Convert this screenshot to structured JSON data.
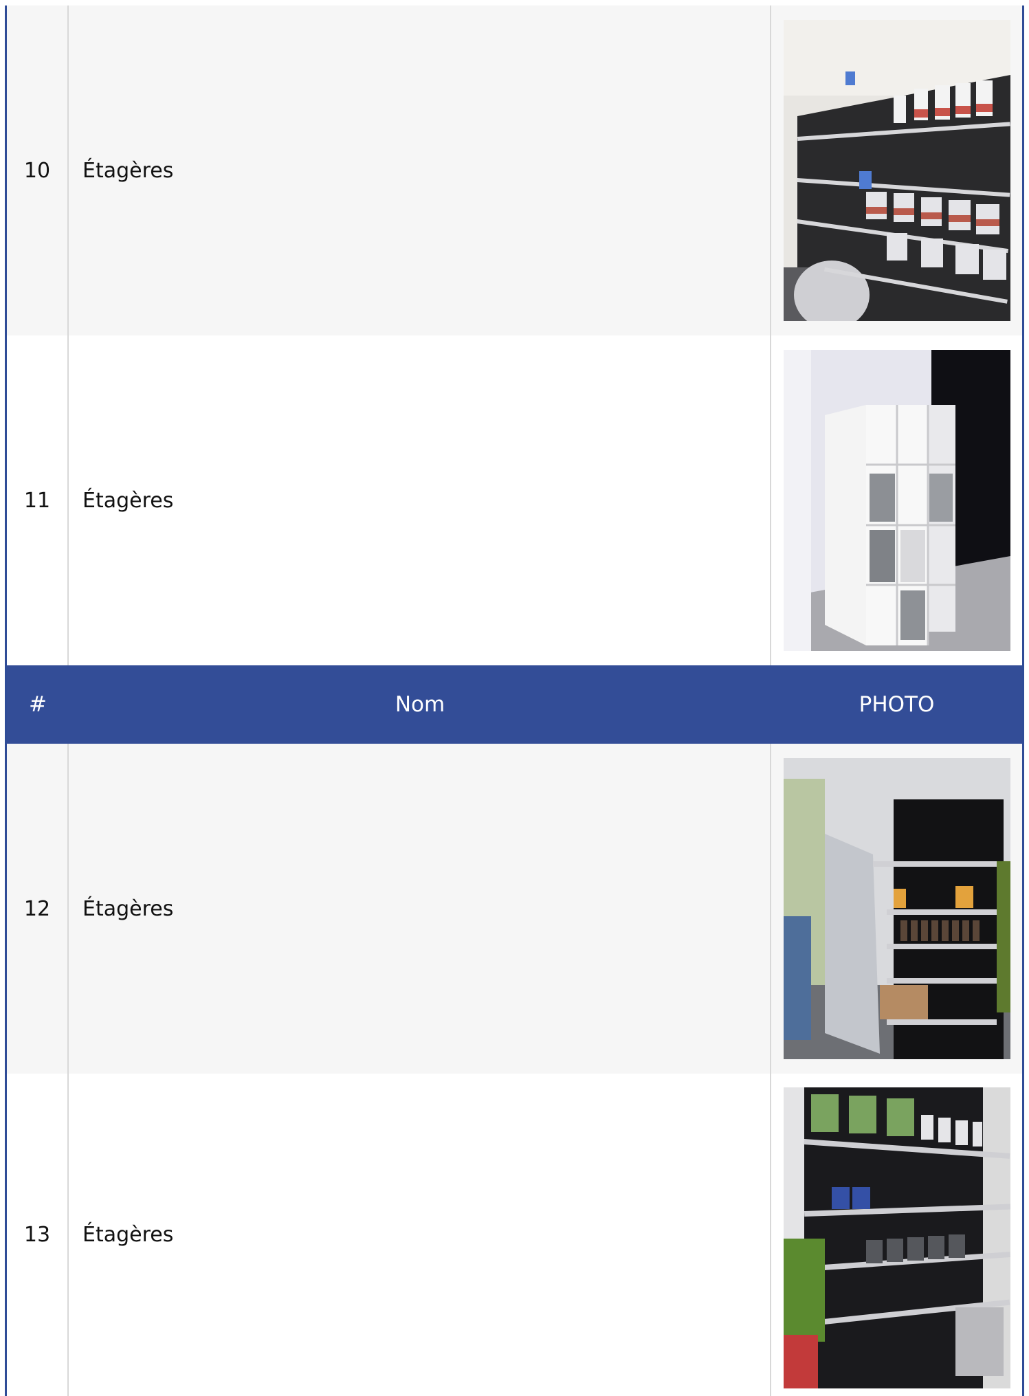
{
  "table": {
    "header": {
      "num": "#",
      "name": "Nom",
      "photo": "PHOTO"
    },
    "rows": [
      {
        "num": "10",
        "name": "Étagères",
        "photo_icon": "shelf-photo-icon"
      },
      {
        "num": "11",
        "name": "Étagères",
        "photo_icon": "shelf-photo-icon"
      },
      {
        "num": "12",
        "name": "Étagères",
        "photo_icon": "shelf-photo-icon"
      },
      {
        "num": "13",
        "name": "Étagères",
        "photo_icon": "shelf-photo-icon"
      }
    ]
  },
  "colors": {
    "header_bg": "#334d97",
    "border": "#2f4c97",
    "alt_row": "#f6f6f6"
  }
}
